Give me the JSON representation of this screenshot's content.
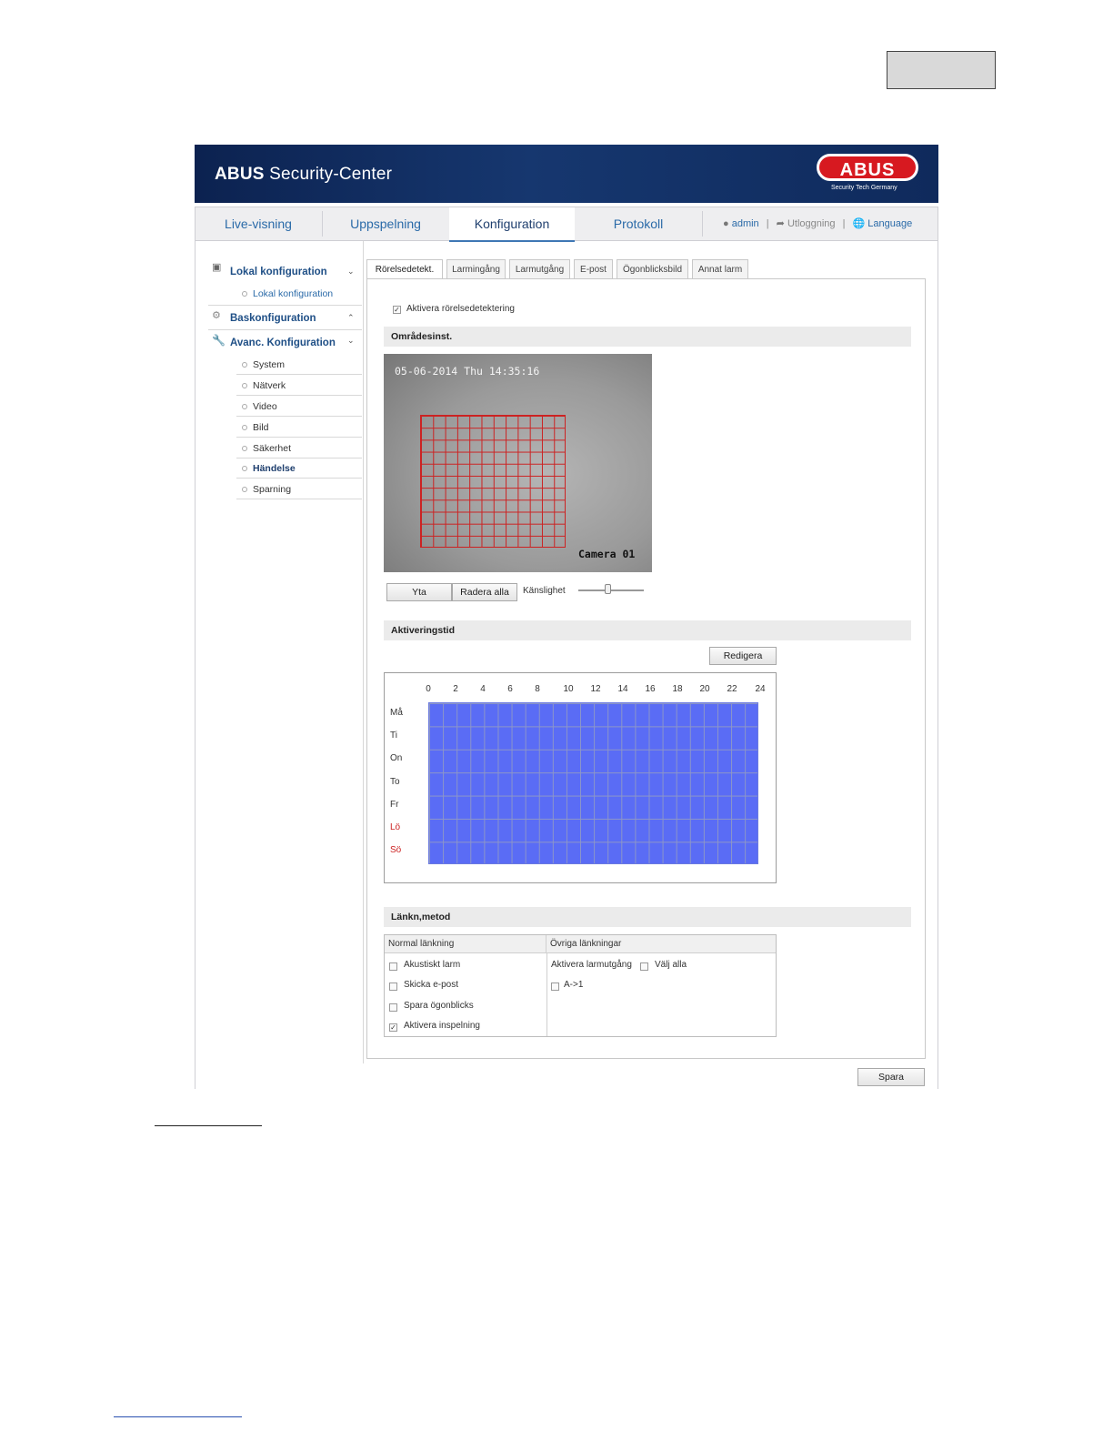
{
  "app": {
    "title_bold": "ABUS",
    "title_rest": " Security-Center",
    "logo": "ABUS",
    "logo_sub": "Security Tech Germany"
  },
  "nav": {
    "tabs": [
      "Live-visning",
      "Uppspelning",
      "Konfiguration",
      "Protokoll"
    ],
    "active": "Konfiguration",
    "user": "admin",
    "logout": "Utloggning",
    "language": "Language",
    "sep": "|"
  },
  "sidebar": {
    "local_header": "Lokal konfiguration",
    "local_items": [
      "Lokal konfiguration"
    ],
    "basic_header": "Baskonfiguration",
    "advanced_header": "Avanc. Konfiguration",
    "advanced_items": [
      "System",
      "Nätverk",
      "Video",
      "Bild",
      "Säkerhet",
      "Händelse",
      "Sparning"
    ],
    "active_item": "Händelse"
  },
  "tabs": [
    "Rörelsedetekt.",
    "Larmingång",
    "Larmutgång",
    "E-post",
    "Ögonblicksbild",
    "Annat larm"
  ],
  "motion": {
    "enable_label": "Aktivera rörelsedetektering",
    "enable_checked": true,
    "area_header": "Områdesinst.",
    "timestamp": "05-06-2014 Thu 14:35:16",
    "camera_name": "Camera 01",
    "area_button": "Yta",
    "clear_button": "Radera alla",
    "sensitivity_label": "Känslighet",
    "sensitivity_value": 0.45
  },
  "schedule": {
    "header": "Aktiveringstid",
    "edit_button": "Redigera",
    "hours": [
      "0",
      "2",
      "4",
      "6",
      "8",
      "10",
      "12",
      "14",
      "16",
      "18",
      "20",
      "22",
      "24"
    ],
    "days": [
      "Må",
      "Ti",
      "On",
      "To",
      "Fr",
      "Lö",
      "Sö"
    ],
    "active_color": "#5a6cf5"
  },
  "linkage": {
    "header": "Länkn,metod",
    "normal_header": "Normal länkning",
    "other_header": "Övriga länkningar",
    "normal_items": [
      {
        "label": "Akustiskt larm",
        "checked": false
      },
      {
        "label": "Skicka e-post",
        "checked": false
      },
      {
        "label": "Spara ögonblicks",
        "checked": false
      },
      {
        "label": "Aktivera inspelning",
        "checked": true
      }
    ],
    "alarm_out_label": "Aktivera larmutgång",
    "select_all": "Välj alla",
    "output_item": "A->1"
  },
  "save_button": "Spara",
  "check_mark": "✓"
}
